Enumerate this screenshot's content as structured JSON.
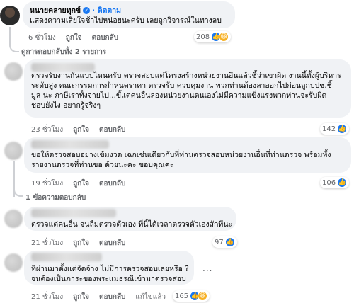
{
  "comments": [
    {
      "author": "หนายคลายทุกข์",
      "follow_label": "· ติดตาม",
      "verified": true,
      "text": "แสดงความเสียใจช้าไปหน่อยนะครับ เลยถูกวิจารณ์ในทางลบ",
      "time": "6 ชั่วโมง",
      "like_label": "ถูกใจ",
      "reply_label": "ตอบกลับ",
      "reaction_count": "208"
    },
    {
      "text_lines": [
        "ตรวจรับงานกันแบบไหนครับ ตรวจสอบแต่โครงสร้างหน่วยงานอื่นแล้วชี้ว่าเขาผิด งานนี้ทั้งผู้บริหาร",
        "ระดับสูง คณะกรรมการกำหนดราคา ตรวจรับ ควบคุมงาน พวกท่านต้องลาออกไปก่อนถูกปปช.ชี้",
        "มูล นะ ภาษีเราทั้งจ่ายไป...ขั้แต่คนอื่นลองหน่วยงานตนเองไม่มีความแข็งแรงพวกท่านจะรับผิด",
        "ชอบยังไง อยากรู้จริงๆ"
      ],
      "time": "23 ชั่วโมง",
      "like_label": "ถูกใจ",
      "reply_label": "ตอบกลับ",
      "reaction_count": "142"
    },
    {
      "text_lines": [
        "ขอให้ตรวจสอบอย่างเข้มงวด เฉกเช่นเดียวกับที่ท่านตรวจสอบหน่วยงานอื่นที่ท่านตรวจ พร้อมทั้ง",
        "รายงานตรวจที่ท่านขอ ด้วยนะคะ ขอบคุณค่ะ"
      ],
      "time": "19 ชั่วโมง",
      "like_label": "ถูกใจ",
      "reply_label": "ตอบกลับ",
      "reaction_count": "106"
    },
    {
      "text": "ตรวจแต่คนอื่น จนลืมตรวจตัวเอง ที่นี้ได้เวลาตรวจตัวเองสักทีนะ",
      "time": "21 ชั่วโมง",
      "like_label": "ถูกใจ",
      "reply_label": "ตอบกลับ",
      "reaction_count": "97"
    },
    {
      "text_lines": [
        "ที่ผ่านมาตั้งแต่จัดจ้าง ไม่มีการตรวจสอบเลยหรือ ?",
        "จนต้องเป็นภาระของพระแม่ธรณีเข้ามาตรวจสอบ"
      ],
      "time": "21 ชั่วโมง",
      "like_label": "ถูกใจ",
      "reply_label": "ตอบกลับ",
      "edited_label": "แก้ไขแล้ว",
      "reaction_count": "165"
    }
  ],
  "view_replies_1": "ดูการตอบกลับทั้ง 2 รายการ",
  "view_replies_2": "1 ข้อความตอบกลับ",
  "more_options": "...",
  "colors": {
    "like": "#1877f2",
    "haha": "#f7b125",
    "bubble": "#f0f2f5",
    "meta": "#65676b"
  }
}
